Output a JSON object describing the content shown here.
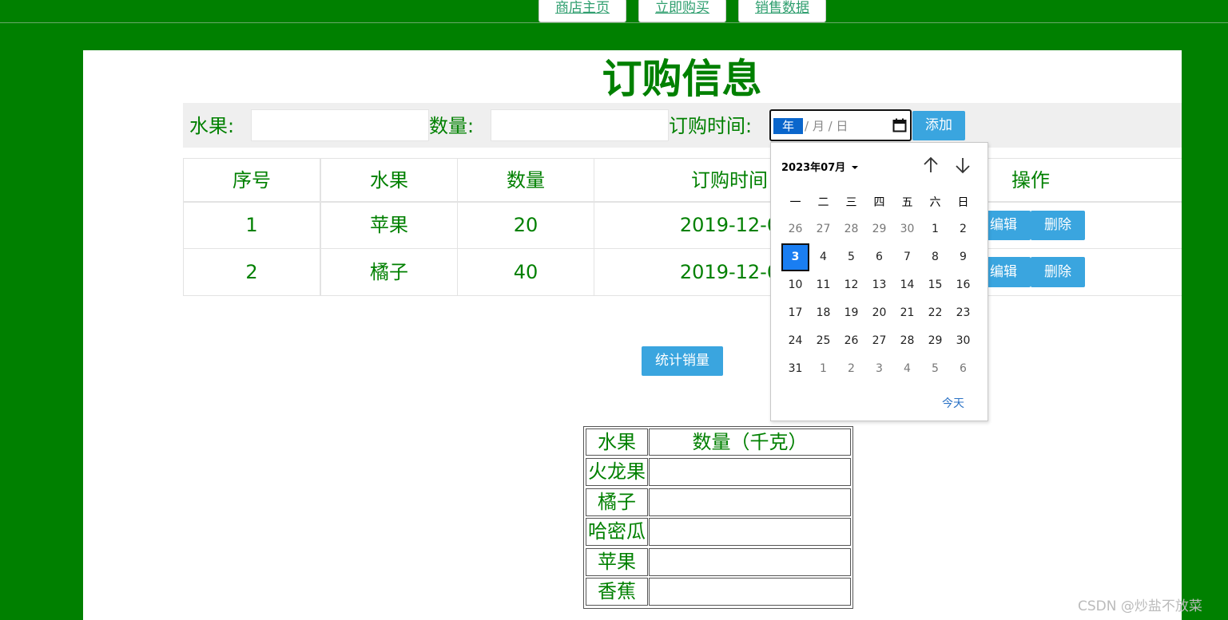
{
  "nav": {
    "items": [
      "商店主页",
      "立即购买",
      "销售数据"
    ]
  },
  "title": "订购信息",
  "form": {
    "fruit_label": "水果:",
    "fruit_value": "",
    "quantity_label": "数量:",
    "quantity_value": "",
    "time_label": "订购时间:",
    "date_year": "年",
    "date_rest": "/ 月 / 日",
    "add_button": "添加"
  },
  "orders": {
    "headers": [
      "序号",
      "水果",
      "数量",
      "订购时间",
      "操作"
    ],
    "header_time_visible": "订购时间",
    "rows": [
      {
        "index": "1",
        "fruit": "苹果",
        "quantity": "20",
        "time": "2019-12-0"
      },
      {
        "index": "2",
        "fruit": "橘子",
        "quantity": "40",
        "time": "2019-12-0"
      }
    ],
    "edit_label": "编辑",
    "delete_label": "删除"
  },
  "stats_button": "统计销量",
  "stats_table": {
    "header_fruit": "水果",
    "header_quantity": "数量（千克）",
    "rows": [
      "火龙果",
      "橘子",
      "哈密瓜",
      "苹果",
      "香蕉"
    ]
  },
  "calendar": {
    "month_label": "2023年07月",
    "weekdays": [
      "一",
      "二",
      "三",
      "四",
      "五",
      "六",
      "日"
    ],
    "weeks": [
      [
        "26",
        "27",
        "28",
        "29",
        "30",
        "1",
        "2"
      ],
      [
        "3",
        "4",
        "5",
        "6",
        "7",
        "8",
        "9"
      ],
      [
        "10",
        "11",
        "12",
        "13",
        "14",
        "15",
        "16"
      ],
      [
        "17",
        "18",
        "19",
        "20",
        "21",
        "22",
        "23"
      ],
      [
        "24",
        "25",
        "26",
        "27",
        "28",
        "29",
        "30"
      ],
      [
        "31",
        "1",
        "2",
        "3",
        "4",
        "5",
        "6"
      ]
    ],
    "selected_day": "3",
    "today_label": "今天"
  },
  "watermark": "CSDN @炒盐不放菜",
  "colors": {
    "background": "#008000",
    "text_green": "#008000",
    "button_blue": "#3aa5df",
    "selected_day": "#1a7ef2"
  }
}
